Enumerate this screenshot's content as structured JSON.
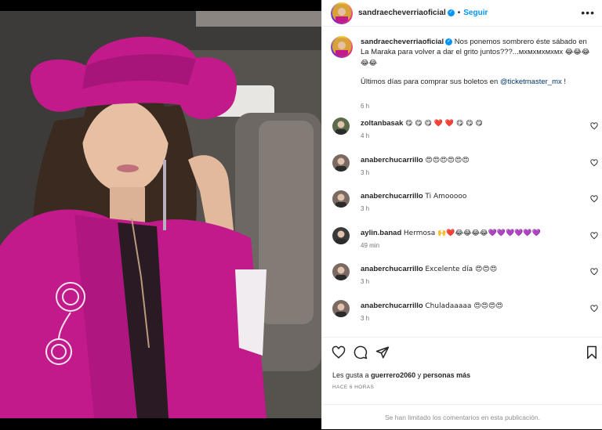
{
  "post": {
    "username": "sandraecheverriaoficial",
    "follow_label": "Seguir",
    "more_icon": "more-options-icon"
  },
  "caption": {
    "username": "sandraecheverriaoficial",
    "text": "Nos ponemos sombrero éste sábado en La Maraka para volver a dar el grito juntos???...мхмхмхмхмх",
    "emojis": "😂😂😂😂😂",
    "line2_prefix": "Últimos días para comprar sus boletos en",
    "mention": "@ticketmaster_mx",
    "line2_suffix": "!",
    "time": "6 h"
  },
  "comments": [
    {
      "username": "zoltanbasak",
      "text": "😋 😋 😋 ❤️ ❤️ 😋 😋 😋",
      "time": "4 h",
      "avatar_color": "#5a6b4a"
    },
    {
      "username": "anaberchucarrillo",
      "text": "😍😍😍😍😍😍",
      "time": "3 h",
      "avatar_color": "#7a6a62"
    },
    {
      "username": "anaberchucarrillo",
      "text": "Ti Amooooo",
      "time": "3 h",
      "avatar_color": "#7a6a62"
    },
    {
      "username": "aylin.banad",
      "text": "Hermosa 🙌❤️😂😂😂😂💜💜💜💜💜💜",
      "time": "49 min",
      "avatar_color": "#3a3a3a"
    },
    {
      "username": "anaberchucarrillo",
      "text": "Excelente día 😍😍😍",
      "time": "3 h",
      "avatar_color": "#7a6a62"
    },
    {
      "username": "anaberchucarrillo",
      "text": "Chuladaaaaa 😍😍😍😍",
      "time": "3 h",
      "avatar_color": "#7a6a62"
    }
  ],
  "actions": {
    "like_icon": "heart-icon",
    "comment_icon": "comment-icon",
    "share_icon": "share-icon",
    "save_icon": "bookmark-icon",
    "likes_prefix": "Les gusta a",
    "likes_user": "guerrero2060",
    "likes_and": "y",
    "likes_more": "personas más",
    "posted": "HACE 6 HORAS"
  },
  "footer": {
    "limited": "Se han limitado los comentarios en esta publicación."
  },
  "colors": {
    "accent": "#0095f6",
    "mention": "#00376b",
    "outfit_pink": "#c21a8a"
  }
}
